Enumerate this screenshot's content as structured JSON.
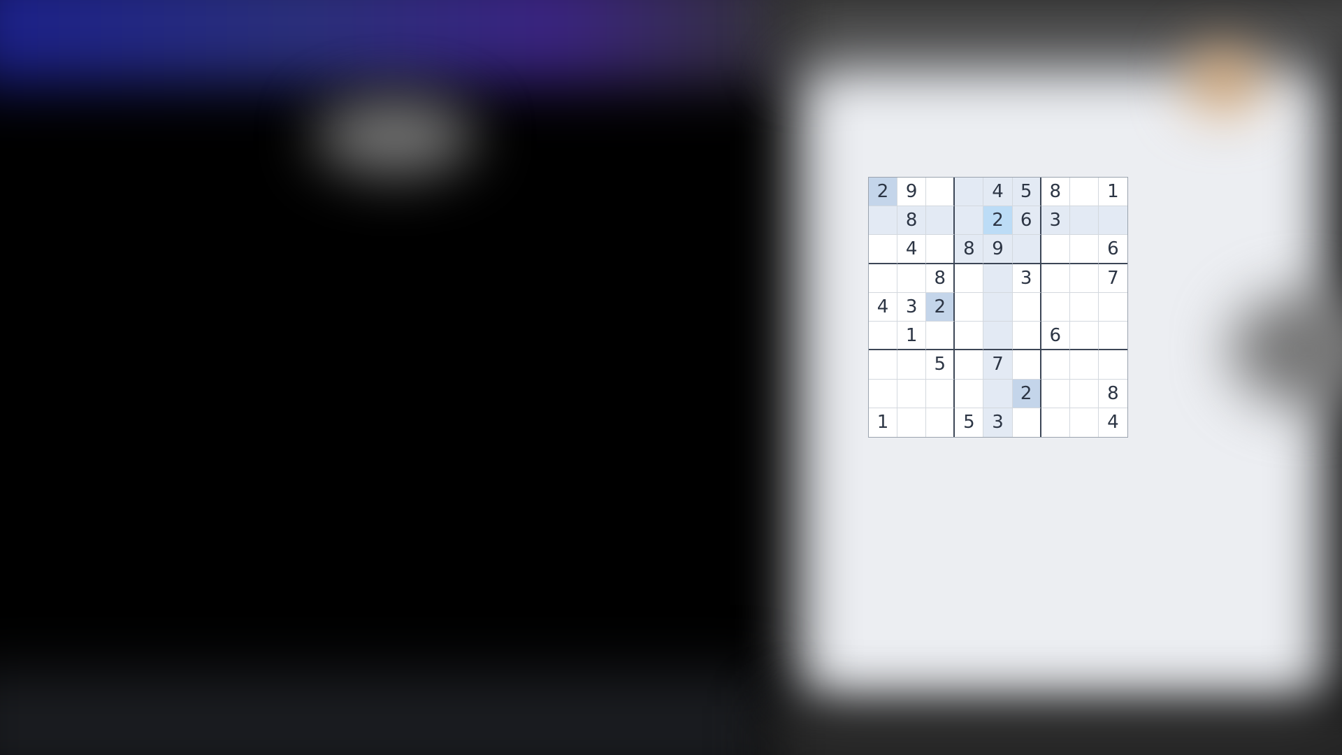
{
  "sudoku": {
    "rows": [
      [
        "2",
        "9",
        "",
        "",
        "4",
        "5",
        "8",
        "",
        "1"
      ],
      [
        "",
        "8",
        "",
        "",
        "2",
        "6",
        "3",
        "",
        ""
      ],
      [
        "",
        "4",
        "",
        "8",
        "9",
        "",
        "",
        "",
        "6"
      ],
      [
        "",
        "",
        "8",
        "",
        "",
        "3",
        "",
        "",
        "7"
      ],
      [
        "4",
        "3",
        "2",
        "",
        "",
        "",
        "",
        "",
        ""
      ],
      [
        "",
        "1",
        "",
        "",
        "",
        "",
        "6",
        "",
        ""
      ],
      [
        "",
        "",
        "5",
        "",
        "7",
        "",
        "",
        "",
        ""
      ],
      [
        "",
        "",
        "",
        "",
        "",
        "2",
        "",
        "",
        "8"
      ],
      [
        "1",
        "",
        "",
        "5",
        "3",
        "",
        "",
        "",
        "4"
      ]
    ],
    "selected": {
      "row": 1,
      "col": 4
    },
    "colors": {
      "highlight": "#e3eaf4",
      "same_number": "#c4d5ea",
      "selected": "#bcdcf6",
      "text": "#2c3544"
    }
  }
}
